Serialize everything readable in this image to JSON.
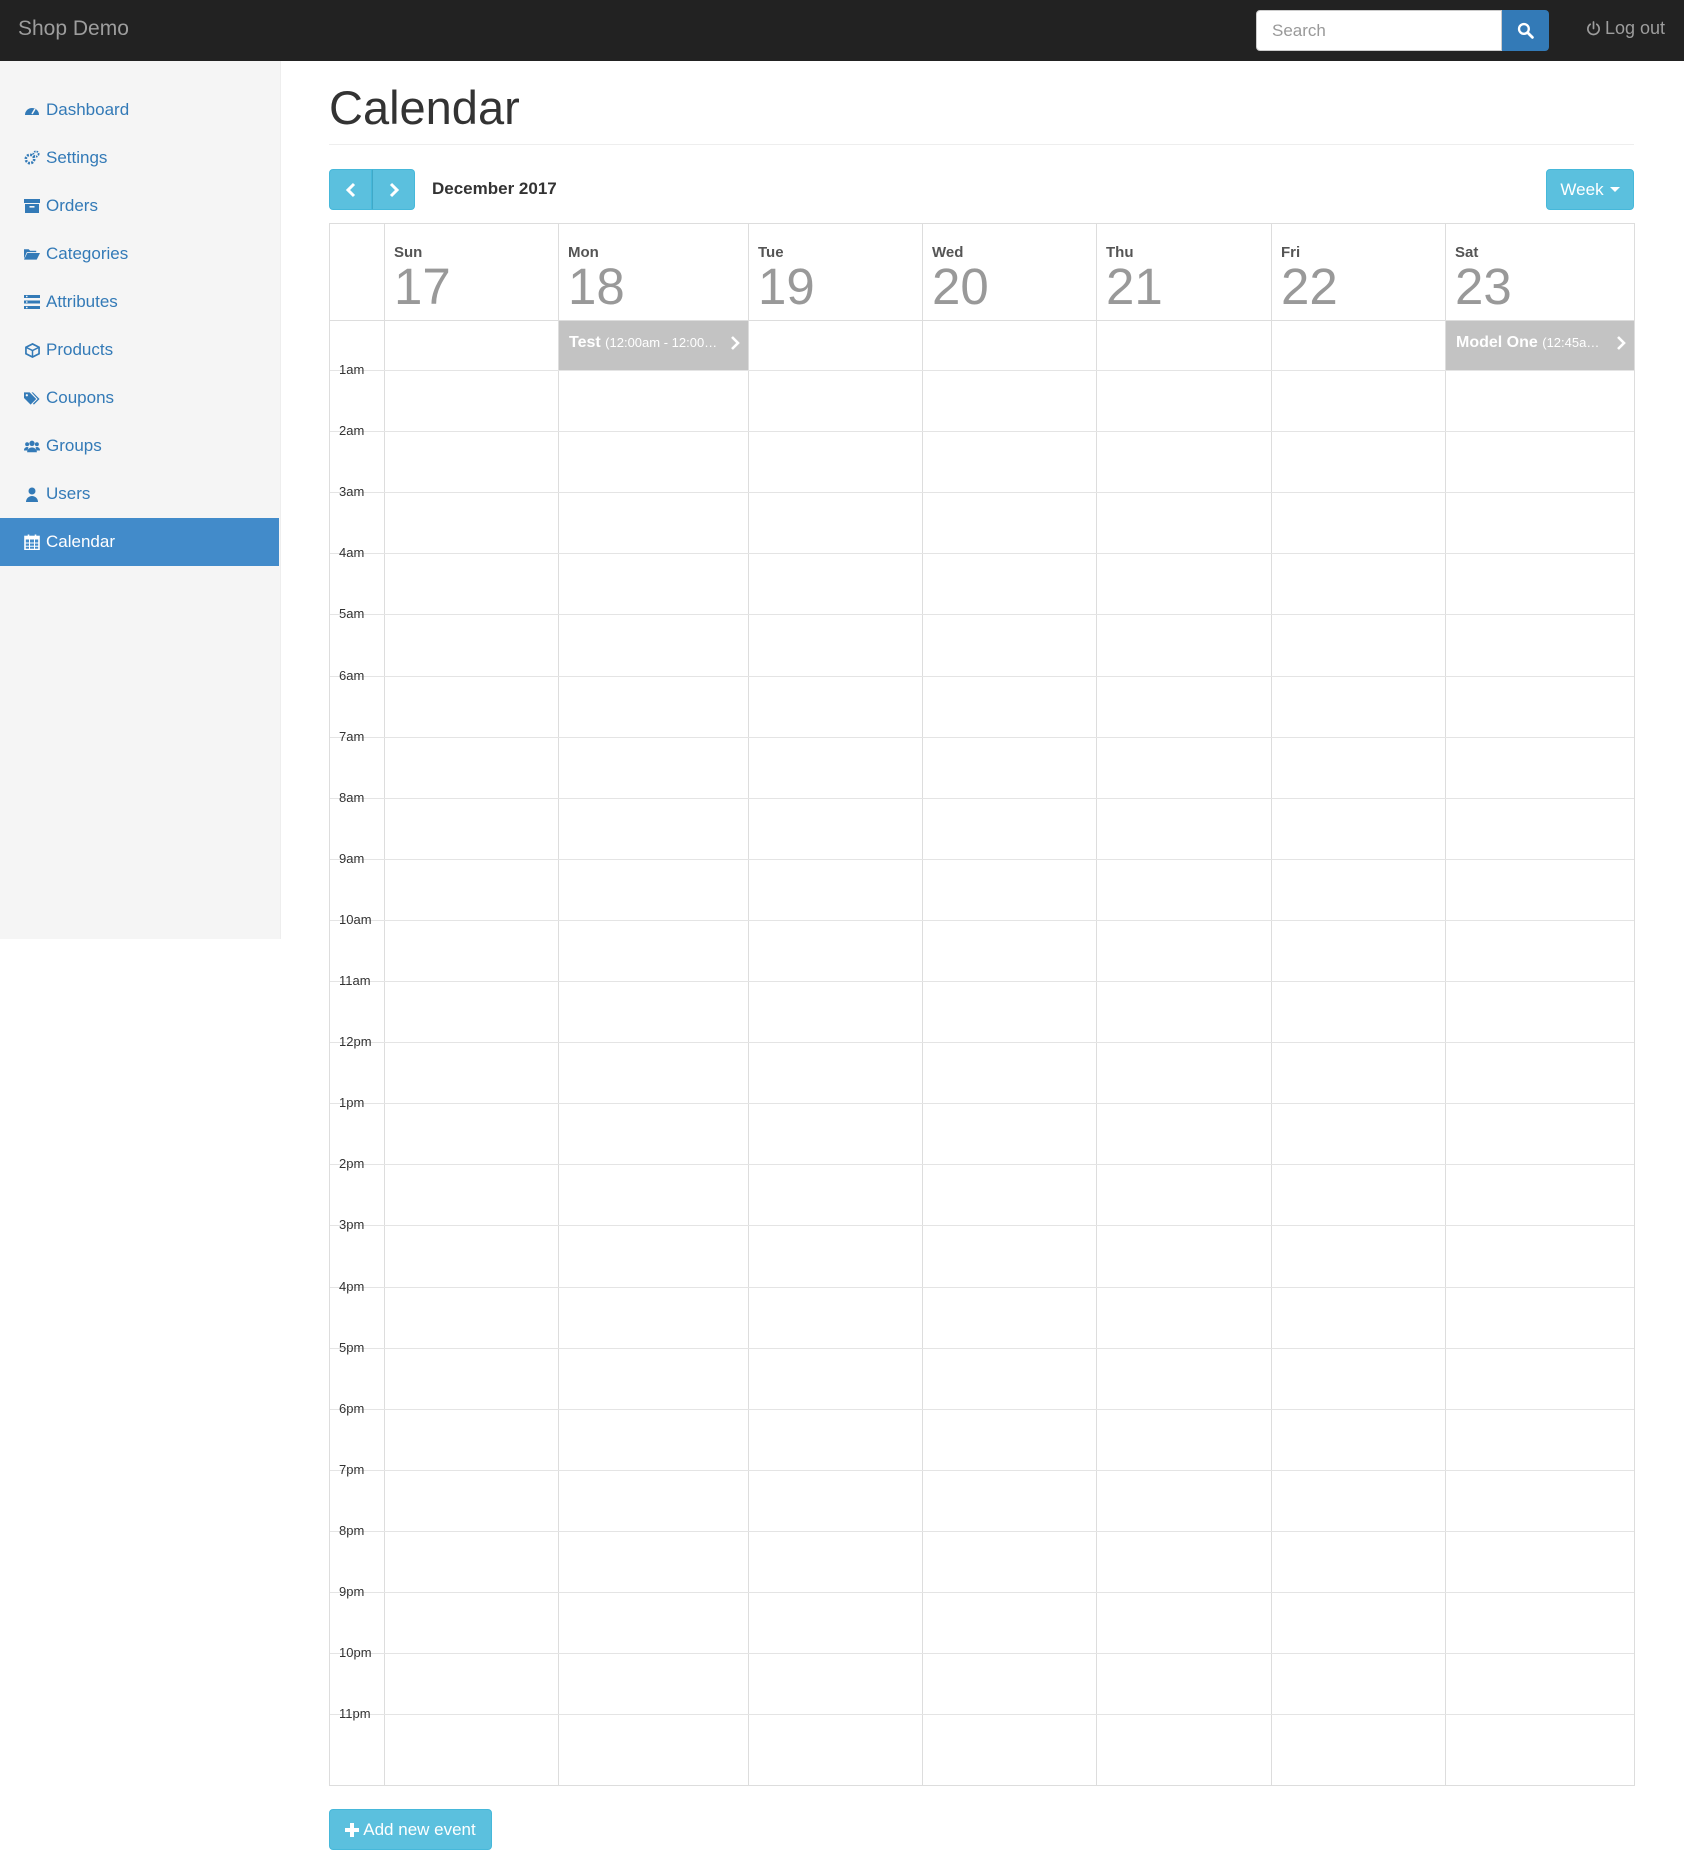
{
  "navbar": {
    "brand": "Shop Demo",
    "search_placeholder": "Search",
    "logout_label": "Log out"
  },
  "sidebar": {
    "items": [
      {
        "label": "Dashboard",
        "icon": "dashboard-icon"
      },
      {
        "label": "Settings",
        "icon": "gears-icon"
      },
      {
        "label": "Orders",
        "icon": "archive-icon"
      },
      {
        "label": "Categories",
        "icon": "folder-open-icon"
      },
      {
        "label": "Attributes",
        "icon": "list-icon"
      },
      {
        "label": "Products",
        "icon": "cube-icon"
      },
      {
        "label": "Coupons",
        "icon": "tags-icon"
      },
      {
        "label": "Groups",
        "icon": "users-icon"
      },
      {
        "label": "Users",
        "icon": "user-icon"
      },
      {
        "label": "Calendar",
        "icon": "calendar-icon",
        "active": true
      }
    ]
  },
  "page": {
    "title": "Calendar",
    "month_label": "December 2017",
    "view_label": "Week",
    "add_event_label": "Add new event"
  },
  "calendar": {
    "days": [
      {
        "name": "Sun",
        "num": "17"
      },
      {
        "name": "Mon",
        "num": "18"
      },
      {
        "name": "Tue",
        "num": "19"
      },
      {
        "name": "Wed",
        "num": "20"
      },
      {
        "name": "Thu",
        "num": "21"
      },
      {
        "name": "Fri",
        "num": "22"
      },
      {
        "name": "Sat",
        "num": "23"
      }
    ],
    "hours": [
      "1am",
      "2am",
      "3am",
      "4am",
      "5am",
      "6am",
      "7am",
      "8am",
      "9am",
      "10am",
      "11am",
      "12pm",
      "1pm",
      "2pm",
      "3pm",
      "4pm",
      "5pm",
      "6pm",
      "7pm",
      "8pm",
      "9pm",
      "10pm",
      "11pm"
    ],
    "events": [
      {
        "day": "Mon",
        "title": "Test",
        "time": "(12:00am - 12:00…"
      },
      {
        "day": "Sat",
        "title": "Model One",
        "time": "(12:45a…"
      }
    ]
  },
  "colors": {
    "navbar_bg": "#222222",
    "primary": "#337ab7",
    "active_nav": "#428bca",
    "info_button": "#5bc0de",
    "event_bg": "#c3c3c3"
  }
}
